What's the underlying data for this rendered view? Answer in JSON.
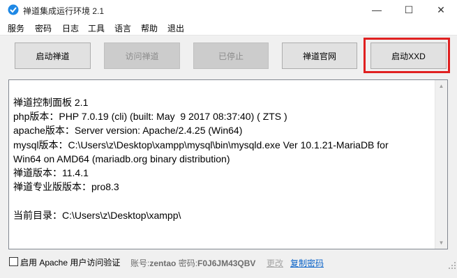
{
  "window": {
    "title": "禅道集成运行环境 2.1",
    "controls": {
      "minimize": "—",
      "maximize": "☐",
      "close": "✕"
    },
    "accent": "#1e88e5"
  },
  "menu": [
    "服务",
    "密码",
    "日志",
    "工具",
    "语言",
    "帮助",
    "退出"
  ],
  "buttons": {
    "start": "启动禅道",
    "visit": "访问禅道",
    "stopped": "已停止",
    "official": "禅道官网",
    "start_xxd": "启动XXD"
  },
  "highlight_color": "#e02020",
  "console": {
    "lines": [
      "禅道控制面板 2.1",
      "php版本：PHP 7.0.19 (cli) (built: May  9 2017 08:37:40) ( ZTS )",
      "apache版本：Server version: Apache/2.4.25 (Win64)",
      "mysql版本：C:\\Users\\z\\Desktop\\xampp\\mysql\\bin\\mysqld.exe  Ver 10.1.21-MariaDB for Win64 on AMD64 (mariadb.org binary distribution)",
      "禅道版本：11.4.1",
      "禅道专业版版本：pro8.3",
      "",
      "当前目录：C:\\Users\\z\\Desktop\\xampp\\"
    ]
  },
  "status": {
    "apache_auth_label": "启用 Apache 用户访问验证",
    "account_label": "账号:",
    "account_value": "zentao",
    "password_label": "密码:",
    "password_value": "F0J6JM43QBV",
    "change_link": "更改",
    "copy_link": "复制密码"
  }
}
